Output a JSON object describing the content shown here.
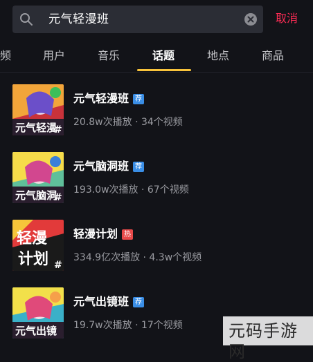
{
  "search": {
    "query": "元气轻漫班",
    "cancel_label": "取消"
  },
  "tabs": [
    {
      "label": "频"
    },
    {
      "label": "用户"
    },
    {
      "label": "音乐"
    },
    {
      "label": "话题"
    },
    {
      "label": "地点"
    },
    {
      "label": "商品"
    }
  ],
  "active_tab": "话题",
  "topics": [
    {
      "title": "元气轻漫班",
      "badge": "荐",
      "badge_color": "#3a8ee6",
      "stats": "20.8w次播放 · 34个视频",
      "thumb_text": "元气轻漫"
    },
    {
      "title": "元气脑洞班",
      "badge": "荐",
      "badge_color": "#3a8ee6",
      "stats": "193.0w次播放 · 67个视频",
      "thumb_text": "元气脑洞"
    },
    {
      "title": "轻漫计划",
      "badge": "热",
      "badge_color": "#e84a4a",
      "stats": "334.9亿次播放 · 4.3w个视频",
      "thumb_text": "轻漫计划"
    },
    {
      "title": "元气出镜班",
      "badge": "荐",
      "badge_color": "#3a8ee6",
      "stats": "19.7w次播放 · 17个视频",
      "thumb_text": "元气出镜"
    }
  ],
  "watermark": "元码手游网",
  "colors": {
    "background": "#121318",
    "accent_red": "#fe2c55",
    "tab_indicator": "#f8c33b"
  }
}
